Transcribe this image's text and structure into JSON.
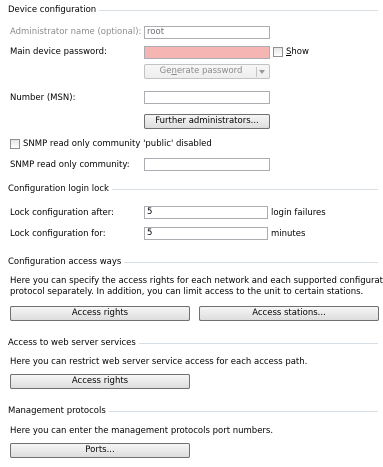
{
  "device_configuration": {
    "title": "Device configuration",
    "admin_name_label": "Administrator name (optional):",
    "admin_name_value": "root",
    "main_password_label": "Main device password:",
    "main_password_value": "",
    "show_label_prefix": "",
    "show_label_accel": "S",
    "show_label_rest": "how",
    "generate_password_prefix": "Ge",
    "generate_password_accel": "n",
    "generate_password_rest": "erate password",
    "number_msn_label": "Number (MSN):",
    "number_msn_value": "",
    "further_admins_label": "Further administrators...",
    "snmp_public_label": "SNMP read only community 'public' disabled",
    "snmp_community_label": "SNMP read only community:",
    "snmp_community_value": ""
  },
  "login_lock": {
    "title": "Configuration login lock",
    "lock_after_label": "Lock configuration after:",
    "lock_after_value": "5",
    "lock_after_unit": "login failures",
    "lock_for_label": "Lock configuration for:",
    "lock_for_value": "5",
    "lock_for_unit": "minutes"
  },
  "access_ways": {
    "title": "Configuration access ways",
    "description_line1": "Here you can specify the access rights for each network and each supported configuration",
    "description_line2": "protocol separately. In addition, you can limit access to the unit to certain stations.",
    "access_rights_label": "Access rights",
    "access_stations_label": "Access stations..."
  },
  "web_server": {
    "title": "Access to web server services",
    "description": "Here you can restrict web server service access for each access path.",
    "access_rights_label": "Access rights"
  },
  "management_protocols": {
    "title": "Management protocols",
    "description": "Here you can enter the management protocols port numbers.",
    "ports_label": "Ports..."
  }
}
